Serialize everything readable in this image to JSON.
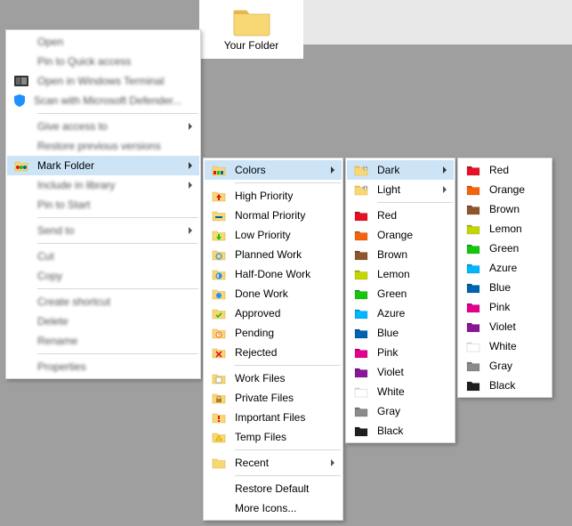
{
  "folder": {
    "label": "Your Folder"
  },
  "context_menu": {
    "items": [
      "Open",
      "Pin to Quick access",
      "Open in Windows Terminal",
      "Scan with Microsoft Defender...",
      "Give access to",
      "Restore previous versions",
      "Mark Folder",
      "Include in library",
      "Pin to Start",
      "Send to",
      "Cut",
      "Copy",
      "Create shortcut",
      "Delete",
      "Rename",
      "Properties"
    ]
  },
  "mark_folder_menu": {
    "colors": "Colors",
    "priorities": [
      "High Priority",
      "Normal Priority",
      "Low Priority"
    ],
    "work_status": [
      "Planned Work",
      "Half-Done Work",
      "Done Work",
      "Approved",
      "Pending",
      "Rejected"
    ],
    "file_groups": [
      "Work Files",
      "Private Files",
      "Important Files",
      "Temp Files"
    ],
    "recent": "Recent",
    "restore_default": "Restore Default",
    "more_icons": "More Icons..."
  },
  "colors_menu": {
    "dark": "Dark",
    "light": "Light",
    "standard": [
      "Red",
      "Orange",
      "Brown",
      "Lemon",
      "Green",
      "Azure",
      "Blue",
      "Pink",
      "Violet",
      "White",
      "Gray",
      "Black"
    ]
  },
  "dark_menu": {
    "colors": [
      "Red",
      "Orange",
      "Brown",
      "Lemon",
      "Green",
      "Azure",
      "Blue",
      "Pink",
      "Violet",
      "White",
      "Gray",
      "Black"
    ]
  },
  "color_hex": {
    "Red": "#e81123",
    "Orange": "#f7630c",
    "Brown": "#8e562e",
    "Lemon": "#c4d600",
    "Green": "#16c60c",
    "Azure": "#00b7ff",
    "Blue": "#0063b1",
    "Pink": "#e3008c",
    "Violet": "#881798",
    "White": "#ffffff",
    "Gray": "#8a8a8a",
    "Black": "#1f1f1f"
  },
  "folder_default": "#f8d775",
  "folder_default_tab": "#e6b74a"
}
